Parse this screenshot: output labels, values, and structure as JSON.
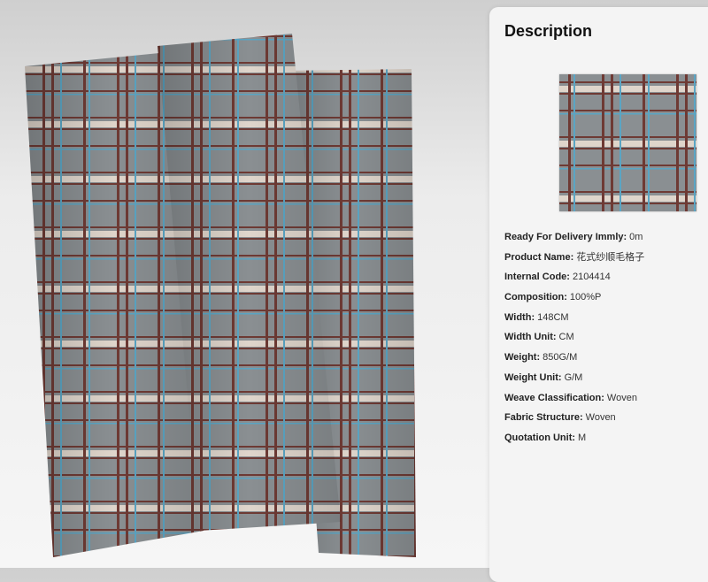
{
  "description": {
    "title": "Description",
    "specs": [
      {
        "label": "Ready For Delivery Immly:",
        "value": "0m"
      },
      {
        "label": "Product Name:",
        "value": "花式纱顺毛格子"
      },
      {
        "label": "Internal Code:",
        "value": "2104414"
      },
      {
        "label": "Composition:",
        "value": "100%P"
      },
      {
        "label": "Width:",
        "value": "148CM"
      },
      {
        "label": "Width Unit:",
        "value": "CM"
      },
      {
        "label": "Weight:",
        "value": "850G/M"
      },
      {
        "label": "Weight Unit:",
        "value": "G/M"
      },
      {
        "label": "Weave Classification:",
        "value": "Woven"
      },
      {
        "label": "Fabric Structure:",
        "value": "Woven"
      },
      {
        "label": "Quotation Unit:",
        "value": "M"
      }
    ]
  },
  "colors": {
    "fabric_base": "#8a8f92",
    "stripe_brown": "#6e3a34",
    "stripe_cream": "#e8ddd2",
    "stripe_blue": "#5aa5c4"
  }
}
